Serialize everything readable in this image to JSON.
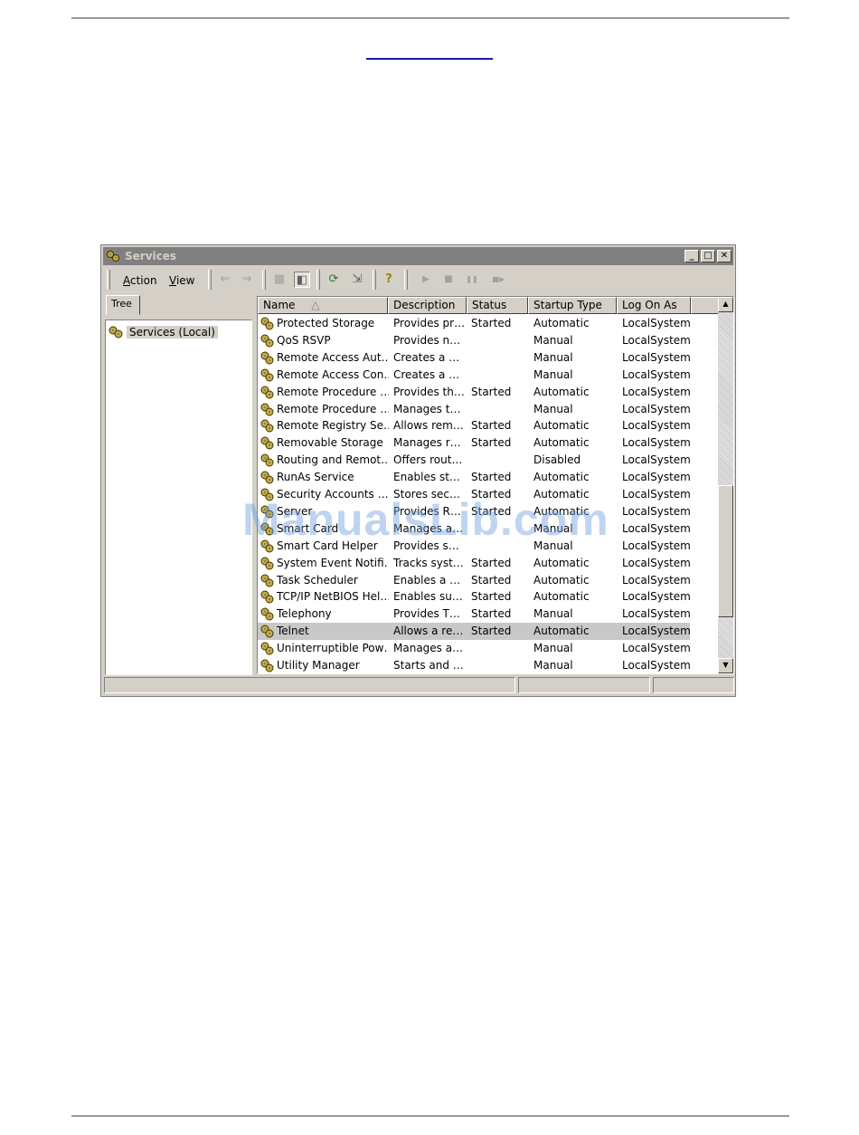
{
  "window": {
    "title": "Services",
    "controls": {
      "minimize": "_",
      "maximize": "□",
      "close": "✕"
    }
  },
  "toolbar": {
    "menus": [
      {
        "label": "Action",
        "hotkey": "A",
        "rest": "ction"
      },
      {
        "label": "View",
        "hotkey": "V",
        "rest": "iew"
      }
    ],
    "tools": [
      {
        "name": "back-icon",
        "glyph": "⇐"
      },
      {
        "name": "forward-icon",
        "glyph": "⇒"
      },
      {
        "name": "up-folder-icon",
        "glyph": "▦"
      },
      {
        "name": "show-hide-tree-icon",
        "glyph": "◧"
      },
      {
        "name": "refresh-icon",
        "glyph": "⟳"
      },
      {
        "name": "export-list-icon",
        "glyph": "⇲"
      },
      {
        "name": "help-icon",
        "glyph": "?"
      },
      {
        "name": "start-service-icon",
        "glyph": "▶"
      },
      {
        "name": "stop-service-icon",
        "glyph": "■"
      },
      {
        "name": "pause-service-icon",
        "glyph": "❚❚"
      },
      {
        "name": "restart-service-icon",
        "glyph": "■▶"
      }
    ]
  },
  "tree": {
    "tab_label": "Tree",
    "node_label": "Services (Local)"
  },
  "list": {
    "columns": [
      "Name",
      "Description",
      "Status",
      "Startup Type",
      "Log On As"
    ],
    "sort_indicator": "△",
    "rows": [
      [
        "Protected Storage",
        "Provides pr…",
        "Started",
        "Automatic",
        "LocalSystem"
      ],
      [
        "QoS RSVP",
        "Provides n…",
        "",
        "Manual",
        "LocalSystem"
      ],
      [
        "Remote Access Aut…",
        "Creates a …",
        "",
        "Manual",
        "LocalSystem"
      ],
      [
        "Remote Access Con…",
        "Creates a …",
        "",
        "Manual",
        "LocalSystem"
      ],
      [
        "Remote Procedure …",
        "Provides th…",
        "Started",
        "Automatic",
        "LocalSystem"
      ],
      [
        "Remote Procedure …",
        "Manages t…",
        "",
        "Manual",
        "LocalSystem"
      ],
      [
        "Remote Registry Se…",
        "Allows rem…",
        "Started",
        "Automatic",
        "LocalSystem"
      ],
      [
        "Removable Storage",
        "Manages r…",
        "Started",
        "Automatic",
        "LocalSystem"
      ],
      [
        "Routing and Remot…",
        "Offers rout…",
        "",
        "Disabled",
        "LocalSystem"
      ],
      [
        "RunAs Service",
        "Enables st…",
        "Started",
        "Automatic",
        "LocalSystem"
      ],
      [
        "Security Accounts …",
        "Stores sec…",
        "Started",
        "Automatic",
        "LocalSystem"
      ],
      [
        "Server",
        "Provides R…",
        "Started",
        "Automatic",
        "LocalSystem"
      ],
      [
        "Smart Card",
        "Manages a…",
        "",
        "Manual",
        "LocalSystem"
      ],
      [
        "Smart Card Helper",
        "Provides s…",
        "",
        "Manual",
        "LocalSystem"
      ],
      [
        "System Event Notifi…",
        "Tracks syst…",
        "Started",
        "Automatic",
        "LocalSystem"
      ],
      [
        "Task Scheduler",
        "Enables a …",
        "Started",
        "Automatic",
        "LocalSystem"
      ],
      [
        "TCP/IP NetBIOS Hel…",
        "Enables su…",
        "Started",
        "Automatic",
        "LocalSystem"
      ],
      [
        "Telephony",
        "Provides T…",
        "Started",
        "Manual",
        "LocalSystem"
      ],
      [
        "Telnet",
        "Allows a re…",
        "Started",
        "Automatic",
        "LocalSystem"
      ],
      [
        "Uninterruptible Pow…",
        "Manages a…",
        "",
        "Manual",
        "LocalSystem"
      ],
      [
        "Utility Manager",
        "Starts and …",
        "",
        "Manual",
        "LocalSystem"
      ]
    ],
    "selected_row": 18
  },
  "scrollbar": {
    "up": "▲",
    "down": "▼"
  },
  "watermark": "ManualsLib.com"
}
